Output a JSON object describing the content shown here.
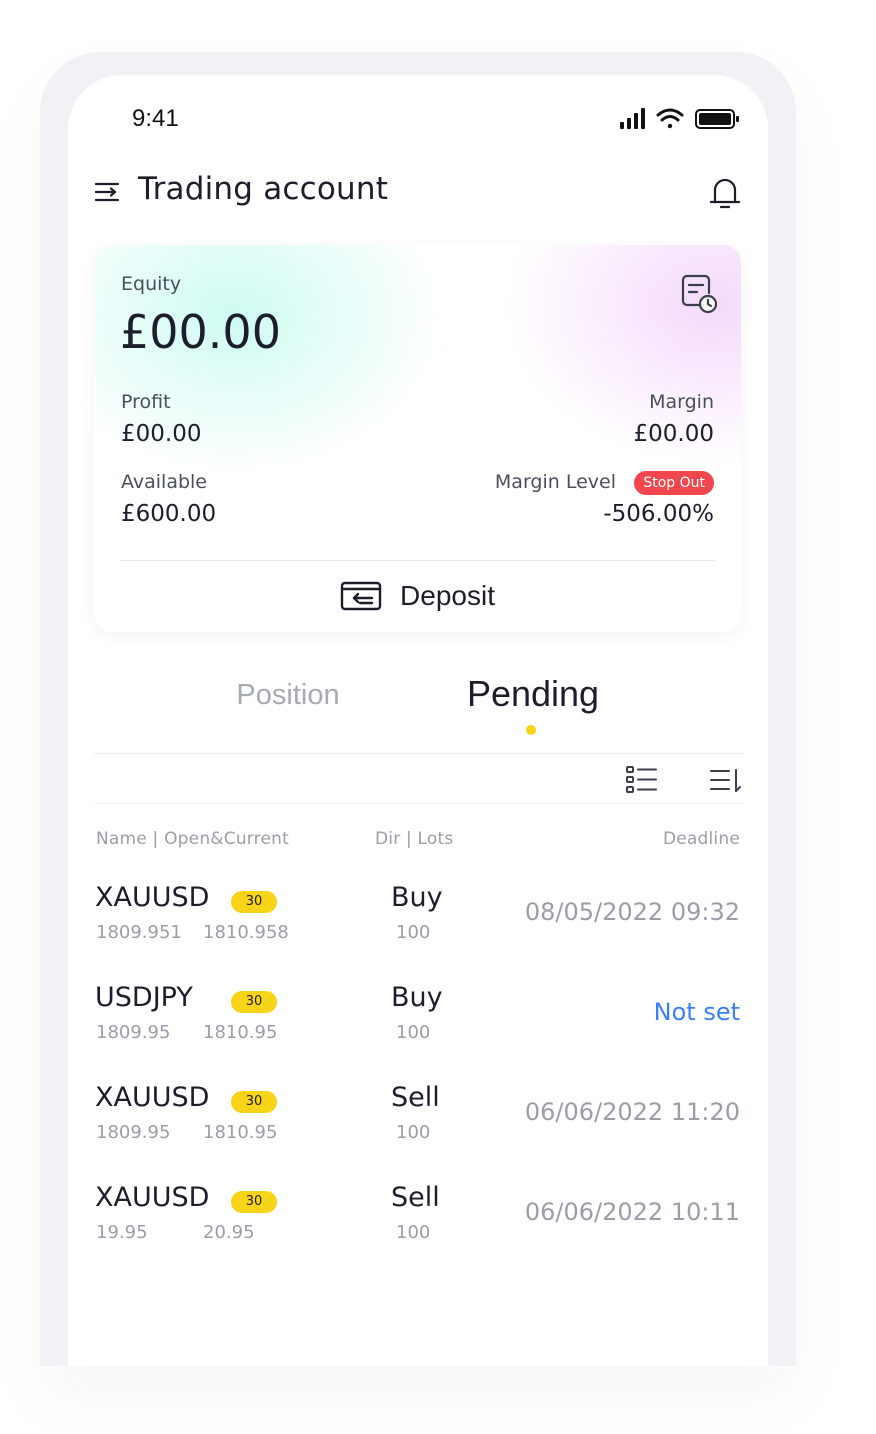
{
  "status_bar": {
    "time": "9:41"
  },
  "header": {
    "title": "Trading account"
  },
  "account": {
    "equity_label": "Equity",
    "equity_value": "£00.00",
    "profit_label": "Profit",
    "profit_value": "£00.00",
    "margin_label": "Margin",
    "margin_value": "£00.00",
    "available_label": "Available",
    "available_value": "£600.00",
    "margin_level_label": "Margin Level",
    "stop_out_badge": "Stop Out",
    "margin_level_value": "-506.00%",
    "deposit_label": "Deposit"
  },
  "tabs": {
    "position": "Position",
    "pending": "Pending",
    "active": "pending"
  },
  "columns": {
    "name": "Name | Open&Current",
    "dir": "Dir | Lots",
    "deadline": "Deadline"
  },
  "orders": [
    {
      "symbol": "XAUUSD",
      "badge": "30",
      "open": "1809.951",
      "current": "1810.958",
      "dir": "Buy",
      "lots": "100",
      "deadline": "08/05/2022 09:32",
      "deadline_set": true
    },
    {
      "symbol": "USDJPY",
      "badge": "30",
      "open": "1809.95",
      "current": "1810.95",
      "dir": "Buy",
      "lots": "100",
      "deadline": "Not set",
      "deadline_set": false
    },
    {
      "symbol": "XAUUSD",
      "badge": "30",
      "open": "1809.95",
      "current": "1810.95",
      "dir": "Sell",
      "lots": "100",
      "deadline": "06/06/2022 11:20",
      "deadline_set": true
    },
    {
      "symbol": "XAUUSD",
      "badge": "30",
      "open": "19.95",
      "current": "20.95",
      "dir": "Sell",
      "lots": "100",
      "deadline": "06/06/2022 10:11",
      "deadline_set": true
    }
  ],
  "colors": {
    "accent_yellow": "#f7d417",
    "stop_out_red": "#f0474f",
    "link_blue": "#3b7ff5"
  },
  "icons": [
    "menu-icon",
    "bell-icon",
    "report-clock-icon",
    "deposit-icon",
    "list-view-icon",
    "sort-icon",
    "signal-icon",
    "wifi-icon",
    "battery-icon"
  ]
}
